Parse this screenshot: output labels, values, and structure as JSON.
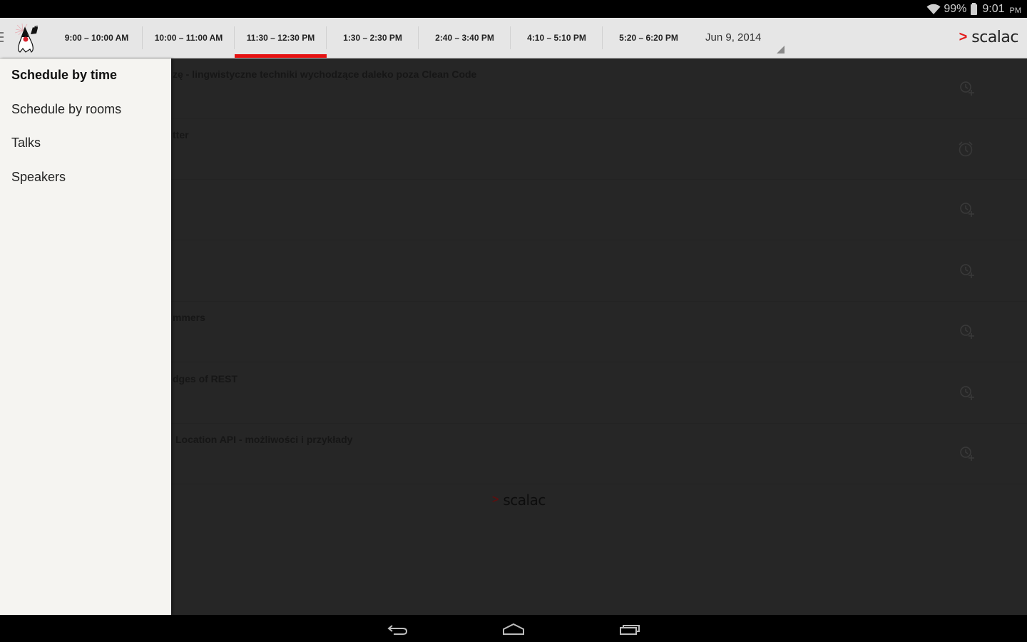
{
  "status_bar": {
    "battery_percent": "99%",
    "time": "9:01",
    "ampm": "PM",
    "icons": [
      "wifi-icon",
      "battery-icon"
    ]
  },
  "action_bar": {
    "app_logo": "duke-mascot-logo",
    "tabs": [
      {
        "label": "9:00 – 10:00 AM",
        "active": false
      },
      {
        "label": "10:00 – 11:00 AM",
        "active": false
      },
      {
        "label": "11:30 – 12:30 PM",
        "active": true
      },
      {
        "label": "1:30 – 2:30 PM",
        "active": false
      },
      {
        "label": "2:40 – 3:40 PM",
        "active": false
      },
      {
        "label": "4:10 – 5:10 PM",
        "active": false
      },
      {
        "label": "5:20 – 6:20 PM",
        "active": false
      }
    ],
    "date_spinner": "Jun 9, 2014",
    "brand": {
      "chevron": ">",
      "name": "scalac"
    },
    "accent_color": "#e61212"
  },
  "drawer": {
    "items": [
      {
        "label": "Schedule by time",
        "selected": true
      },
      {
        "label": "Schedule by rooms",
        "selected": false
      },
      {
        "label": "Talks",
        "selected": false
      },
      {
        "label": "Speakers",
        "selected": false
      }
    ]
  },
  "talks": [
    {
      "title_visible": "zę - lingwistyczne techniki wychodzące daleko poza Clean Code",
      "alarm": "alarm-add-icon"
    },
    {
      "title_visible": "tter",
      "alarm": "alarm-icon"
    },
    {
      "title_visible": "",
      "alarm": "alarm-add-icon"
    },
    {
      "title_visible": "",
      "alarm": "alarm-add-icon"
    },
    {
      "title_visible": "mmers",
      "alarm": "alarm-add-icon"
    },
    {
      "title_visible": "dges of REST",
      "alarm": "alarm-add-icon"
    },
    {
      "title_visible": "Location API - możliwości i przykłady",
      "alarm": "alarm-add-icon"
    }
  ],
  "footer_brand": {
    "chevron": ">",
    "name": "scalac"
  },
  "nav_bar": {
    "buttons": [
      "back",
      "home",
      "recent-apps"
    ]
  }
}
